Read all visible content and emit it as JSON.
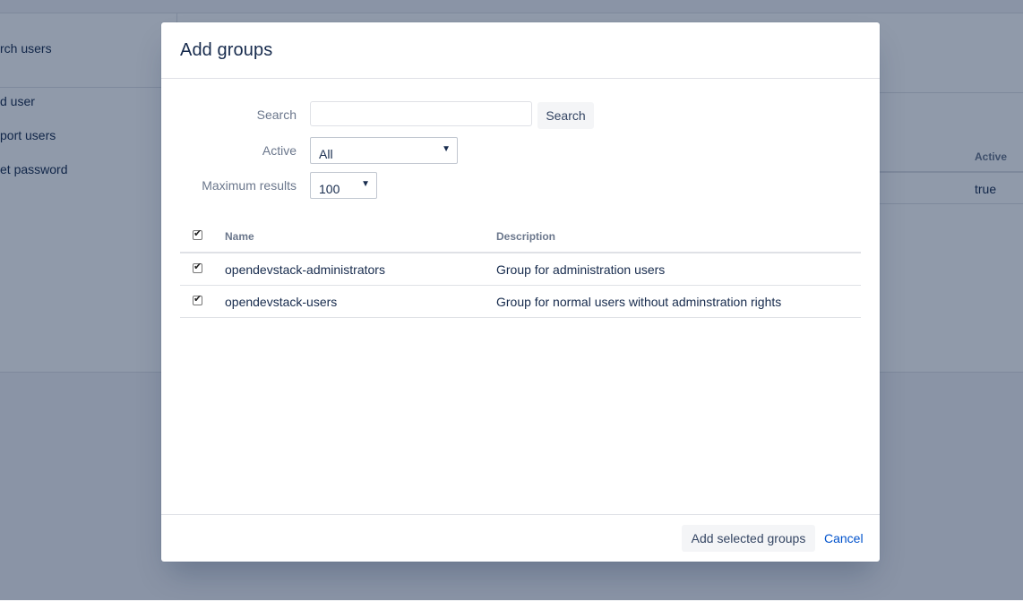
{
  "background": {
    "sidebar_items": [
      "rch users",
      "d user",
      "port users",
      "et password"
    ],
    "table": {
      "column_header": "Active",
      "cell_value": "true"
    }
  },
  "dialog": {
    "title": "Add groups",
    "search": {
      "label": "Search",
      "value": "",
      "placeholder": "",
      "button_label": "Search"
    },
    "active": {
      "label": "Active",
      "selected": "All"
    },
    "max_results": {
      "label": "Maximum results",
      "selected": "100"
    },
    "table": {
      "select_all_checked": true,
      "columns": [
        "Name",
        "Description"
      ],
      "rows": [
        {
          "checked": true,
          "name": "opendevstack-administrators",
          "description": "Group for administration users"
        },
        {
          "checked": true,
          "name": "opendevstack-users",
          "description": "Group for normal users without adminstration rights"
        }
      ]
    },
    "footer": {
      "add_button_label": "Add selected groups",
      "cancel_label": "Cancel"
    }
  },
  "icons": {
    "checkbox": "checkmark-icon",
    "dropdown": "caret-down-icon"
  },
  "colors": {
    "link": "#0052cc",
    "overlay": "#091e42",
    "text": "#172b4d",
    "muted": "#6b778c"
  }
}
